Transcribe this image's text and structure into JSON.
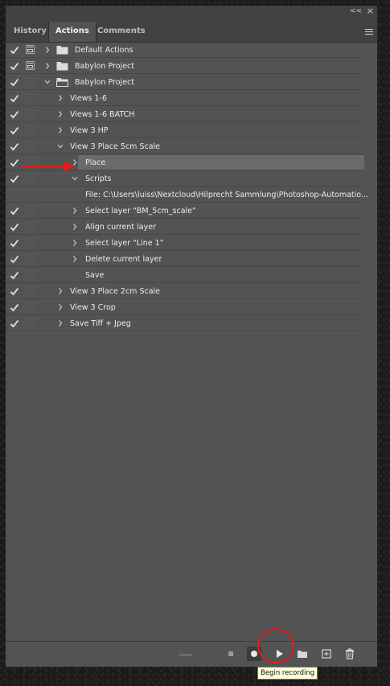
{
  "tabs": [
    {
      "label": "History",
      "active": false
    },
    {
      "label": "Actions",
      "active": true
    },
    {
      "label": "Comments",
      "active": false
    }
  ],
  "title_controls": {
    "collapse": "<<",
    "close": "×"
  },
  "rows": [
    {
      "label": "Default Actions",
      "checked": true,
      "dialog": true,
      "chevron": "right",
      "folder": "closed",
      "selected": false
    },
    {
      "label": "Babylon Project",
      "checked": true,
      "dialog": true,
      "chevron": "right",
      "folder": "closed",
      "selected": false
    },
    {
      "label": "Babylon Project",
      "checked": true,
      "dialog": false,
      "chevron": "down",
      "folder": "open",
      "selected": false
    },
    {
      "label": "Views 1-6",
      "checked": true,
      "dialog": false,
      "chevron": "right",
      "selected": false
    },
    {
      "label": "Views 1-6 BATCH",
      "checked": true,
      "dialog": false,
      "chevron": "right",
      "selected": false
    },
    {
      "label": "View 3 HP",
      "checked": true,
      "dialog": false,
      "chevron": "right",
      "selected": false
    },
    {
      "label": "View 3 Place 5cm Scale",
      "checked": true,
      "dialog": false,
      "chevron": "down",
      "selected": false
    },
    {
      "label": "Place",
      "checked": true,
      "dialog": false,
      "chevron": "right",
      "selected": true
    },
    {
      "label": "Scripts",
      "checked": true,
      "dialog": false,
      "chevron": "down",
      "selected": false
    },
    {
      "label": "File: C:\\Users\\luiss\\Nextcloud\\Hilprecht Sammlung\\Photoshop-Automatio...",
      "checked": false,
      "dialog": false,
      "chevron": "none",
      "selected": false
    },
    {
      "label": "Select layer “BM_5cm_scale”",
      "checked": true,
      "dialog": false,
      "chevron": "right",
      "selected": false
    },
    {
      "label": "Align current layer",
      "checked": true,
      "dialog": false,
      "chevron": "right",
      "selected": false
    },
    {
      "label": "Select layer “Line 1”",
      "checked": true,
      "dialog": false,
      "chevron": "right",
      "selected": false
    },
    {
      "label": "Delete current layer",
      "checked": true,
      "dialog": false,
      "chevron": "right",
      "selected": false
    },
    {
      "label": "Save",
      "checked": true,
      "dialog": false,
      "chevron": "none",
      "selected": false
    },
    {
      "label": "View 3 Place 2cm Scale",
      "checked": true,
      "dialog": false,
      "chevron": "right",
      "selected": false
    },
    {
      "label": "View 3 Crop",
      "checked": true,
      "dialog": false,
      "chevron": "right",
      "selected": false
    },
    {
      "label": "Save Tiff + Jpeg",
      "checked": true,
      "dialog": false,
      "chevron": "right",
      "selected": false
    }
  ],
  "toolbar": {
    "buttons": [
      "stop-icon",
      "record-icon",
      "play-icon",
      "folder-icon",
      "new-action-icon",
      "trash-icon"
    ],
    "tooltip": "Begin recording"
  },
  "colors": {
    "annotation": "#e31b1b",
    "panel": "#535353",
    "selected_row": "#6a6a6a"
  }
}
